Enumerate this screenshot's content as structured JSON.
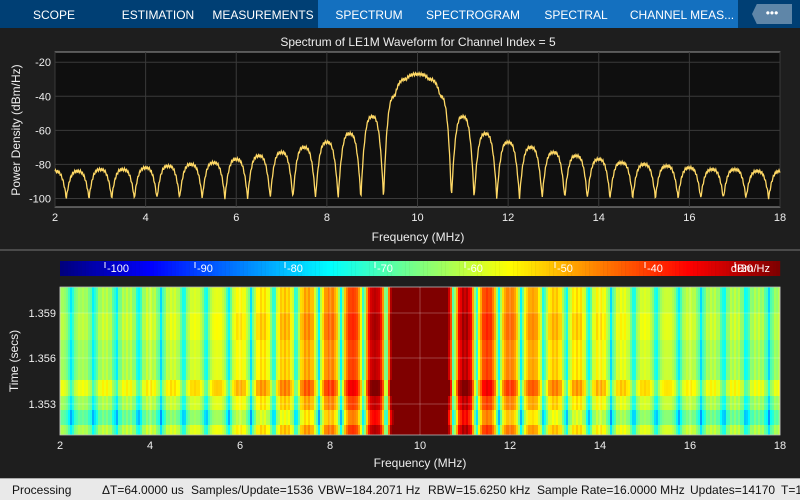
{
  "tabs": [
    {
      "label": "SCOPE"
    },
    {
      "label": "ESTIMATION"
    },
    {
      "label": "MEASUREMENTS"
    },
    {
      "label": "SPECTRUM",
      "active": true
    },
    {
      "label": "SPECTROGRAM",
      "active": true
    },
    {
      "label": "SPECTRAL MASK",
      "active": true
    },
    {
      "label": "CHANNEL MEAS..."
    }
  ],
  "more_label": "•••",
  "chart_data": [
    {
      "type": "line",
      "title": "Spectrum of LE1M Waveform for Channel Index = 5",
      "xlabel": "Frequency (MHz)",
      "ylabel": "Power Density (dBm/Hz)",
      "xlim": [
        2,
        18
      ],
      "ylim": [
        -105,
        -14
      ],
      "xticks": [
        "2",
        "4",
        "6",
        "8",
        "10",
        "12",
        "14",
        "16",
        "18"
      ],
      "yticks": [
        "-20",
        "-40",
        "-60",
        "-80",
        "-100"
      ],
      "grid": true,
      "line_color": "#ffd966",
      "x": [
        2,
        2.25,
        2.5,
        2.75,
        3,
        3.25,
        3.5,
        3.75,
        4,
        4.25,
        4.5,
        4.75,
        5,
        5.25,
        5.5,
        5.75,
        6,
        6.25,
        6.5,
        6.75,
        7,
        7.25,
        7.5,
        7.75,
        8,
        8.25,
        8.5,
        8.75,
        9,
        9.25,
        9.5,
        9.75,
        10,
        10.25,
        10.5,
        10.75,
        11,
        11.25,
        11.5,
        11.75,
        12,
        12.25,
        12.5,
        12.75,
        13,
        13.25,
        13.5,
        13.75,
        14,
        14.25,
        14.5,
        14.75,
        15,
        15.25,
        15.5,
        15.75,
        16,
        16.25,
        16.5,
        16.75,
        17,
        17.25,
        17.5,
        17.75,
        18
      ],
      "y": [
        -84,
        -100,
        -84,
        -100,
        -83,
        -100,
        -83,
        -100,
        -82,
        -100,
        -81,
        -100,
        -80,
        -100,
        -79,
        -100,
        -77,
        -100,
        -75,
        -100,
        -73,
        -100,
        -70,
        -100,
        -67,
        -100,
        -62,
        -100,
        -52,
        -100,
        -40,
        -30,
        -27,
        -30,
        -40,
        -100,
        -52,
        -100,
        -62,
        -100,
        -67,
        -100,
        -70,
        -100,
        -73,
        -100,
        -75,
        -100,
        -77,
        -100,
        -79,
        -100,
        -80,
        -100,
        -81,
        -100,
        -82,
        -100,
        -83,
        -100,
        -83,
        -100,
        -84,
        -100,
        -84
      ]
    },
    {
      "type": "heatmap",
      "xlabel": "Frequency (MHz)",
      "ylabel": "Time (secs)",
      "xlim": [
        2,
        18
      ],
      "xticks": [
        "2",
        "4",
        "6",
        "8",
        "10",
        "12",
        "14",
        "16",
        "18"
      ],
      "yticks": [
        "1.359",
        "1.356",
        "1.353"
      ],
      "colorbar": {
        "ticks": [
          "-100",
          "-90",
          "-80",
          "-70",
          "-60",
          "-50",
          "-40",
          "-30"
        ],
        "unit": "dBm/Hz",
        "range": [
          -105,
          -25
        ],
        "colormap": "jet"
      }
    }
  ],
  "status": {
    "state": "Processing",
    "dt": "ΔT=64.0000 us",
    "samples": "Samples/Update=1536",
    "vbw": "VBW=184.2071 Hz",
    "rbw": "RBW=15.6250 kHz",
    "fs": "Sample Rate=16.0000 MHz",
    "updates": "Updates=14170",
    "t": "T=1"
  }
}
